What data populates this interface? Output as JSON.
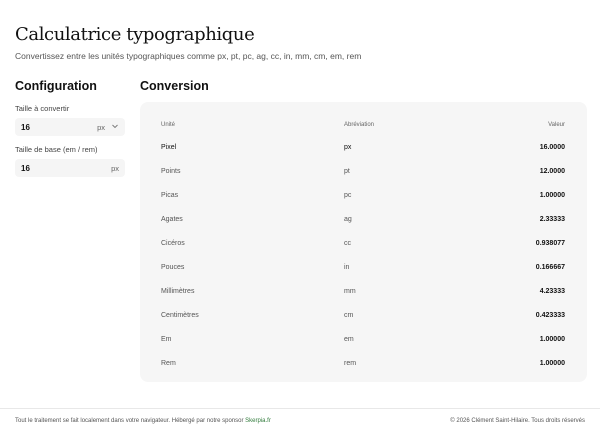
{
  "header": {
    "title": "Calculatrice typographique",
    "subtitle": "Convertissez entre les unités typographiques comme px, pt, pc, ag, cc, in, mm, cm, em, rem"
  },
  "config": {
    "title": "Configuration",
    "size_label": "Taille à convertir",
    "size_value": "16",
    "size_unit": "px",
    "base_label": "Taille de base (em / rem)",
    "base_value": "16",
    "base_unit": "px"
  },
  "conversion": {
    "title": "Conversion",
    "headers": {
      "unit": "Unité",
      "abbr": "Abréviation",
      "value": "Valeur"
    },
    "rows": [
      {
        "unit": "Pixel",
        "abbr": "px",
        "value": "16.0000"
      },
      {
        "unit": "Points",
        "abbr": "pt",
        "value": "12.0000"
      },
      {
        "unit": "Picas",
        "abbr": "pc",
        "value": "1.00000"
      },
      {
        "unit": "Agates",
        "abbr": "ag",
        "value": "2.33333"
      },
      {
        "unit": "Cicéros",
        "abbr": "cc",
        "value": "0.938077"
      },
      {
        "unit": "Pouces",
        "abbr": "in",
        "value": "0.166667"
      },
      {
        "unit": "Millimètres",
        "abbr": "mm",
        "value": "4.23333"
      },
      {
        "unit": "Centimètres",
        "abbr": "cm",
        "value": "0.423333"
      },
      {
        "unit": "Em",
        "abbr": "em",
        "value": "1.00000"
      },
      {
        "unit": "Rem",
        "abbr": "rem",
        "value": "1.00000"
      }
    ]
  },
  "footer": {
    "left_text": "Tout le traitement se fait localement dans votre navigateur. Hébergé par notre sponsor ",
    "sponsor": "Skerpia.fr",
    "right_text": "© 2026 Clément Saint-Hilaire. Tous droits réservés"
  },
  "colors": {
    "accent_link": "#2f7a3a",
    "panel_bg": "#f6f6f6",
    "field_bg": "#f5f5f5"
  }
}
